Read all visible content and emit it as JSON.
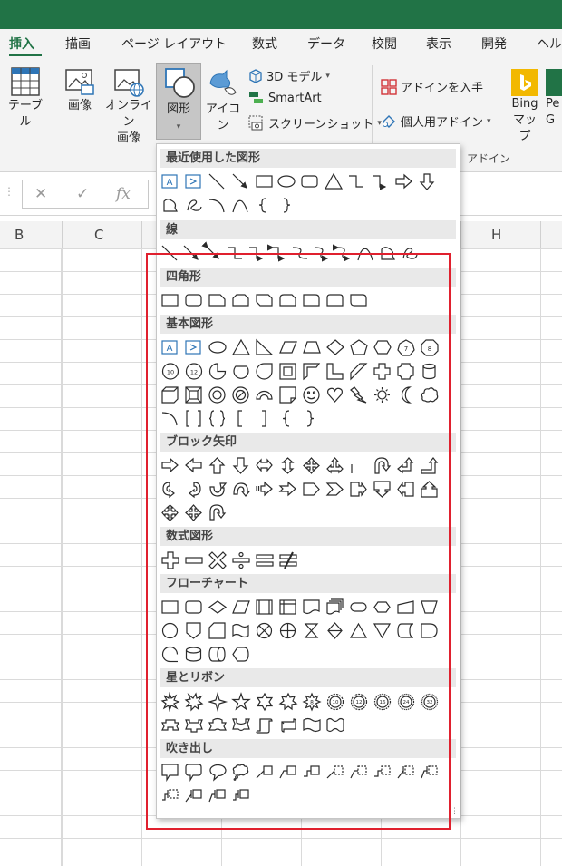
{
  "tabs": [
    "挿入",
    "描画",
    "ページ レイアウト",
    "数式",
    "データ",
    "校閲",
    "表示",
    "開発",
    "ヘル"
  ],
  "ribbon": {
    "table": "テーブル",
    "image": "画像",
    "online_image_1": "オンライン",
    "online_image_2": "画像",
    "shapes": "図形",
    "icons": "アイコン",
    "model3d": "3D モデル",
    "smartart": "SmartArt",
    "screenshot": "スクリーンショット",
    "get_addins": "アドインを入手",
    "my_addins": "個人用アドイン",
    "bing_1": "Bing",
    "bing_2": "マップ",
    "people_1": "Pe",
    "people_2": "G",
    "addins_group": "アドイン"
  },
  "formula_bar": {
    "cancel": "✕",
    "enter": "✓",
    "fx": "fx"
  },
  "columns": {
    "b": "B",
    "c": "C",
    "h": "H"
  },
  "categories": {
    "recent": "最近使用した図形",
    "lines": "線",
    "rectangles": "四角形",
    "basic": "基本図形",
    "block_arrows": "ブロック矢印",
    "equation": "数式図形",
    "flowchart": "フローチャート",
    "stars": "星とリボン",
    "callouts": "吹き出し"
  },
  "shape_labels": {
    "octagon_number": "8",
    "decagon_number": "10",
    "dodecagon_number": "12",
    "heptagon_number": "7",
    "star8": "8",
    "star10": "10",
    "star12": "12",
    "star16": "16",
    "star24": "24",
    "star32": "32"
  },
  "colors": {
    "accent": "#217346",
    "highlight": "#e0202e",
    "icon_blue": "#2e75b6"
  }
}
